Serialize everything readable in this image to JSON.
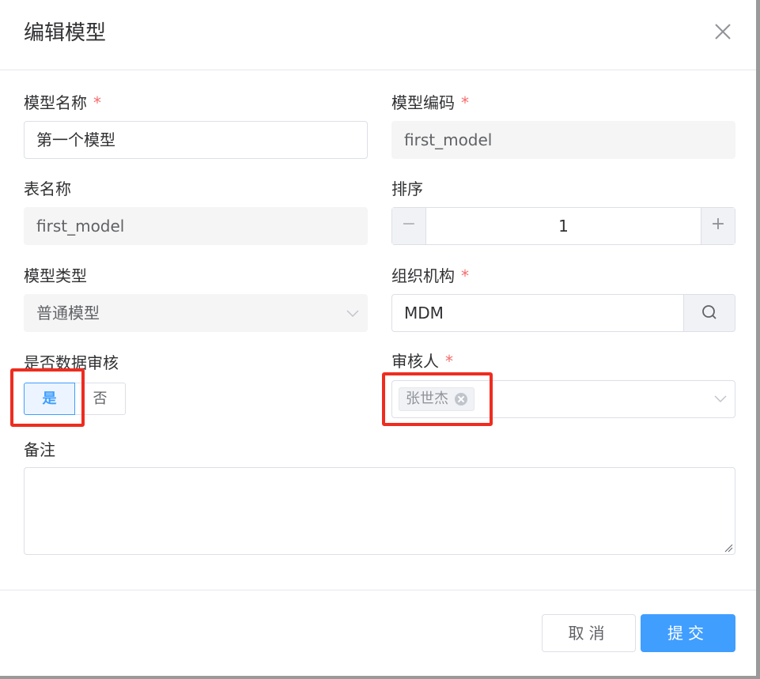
{
  "dialog": {
    "title": "编辑模型"
  },
  "form": {
    "model_name": {
      "label": "模型名称",
      "required_mark": "*",
      "value": "第一个模型"
    },
    "model_code": {
      "label": "模型编码",
      "required_mark": "*",
      "value": "first_model"
    },
    "table_name": {
      "label": "表名称",
      "value": "first_model"
    },
    "sort": {
      "label": "排序",
      "value": "1",
      "minus": "−",
      "plus": "+"
    },
    "model_type": {
      "label": "模型类型",
      "value": "普通模型"
    },
    "organization": {
      "label": "组织机构",
      "required_mark": "*",
      "value": "MDM"
    },
    "data_review": {
      "label": "是否数据审核",
      "options": [
        "是",
        "否"
      ],
      "selected": "是"
    },
    "reviewer": {
      "label": "审核人",
      "required_mark": "*",
      "tags": [
        "张世杰"
      ]
    },
    "remark": {
      "label": "备注",
      "value": ""
    }
  },
  "footer": {
    "cancel_label": "取消",
    "submit_label": "提交"
  },
  "colors": {
    "primary": "#409eff",
    "required": "#f56c6c",
    "highlight": "#ee2c1f"
  },
  "icons": {
    "close": "close-icon",
    "search": "search-icon",
    "dropdown": "chevron-down-icon"
  }
}
